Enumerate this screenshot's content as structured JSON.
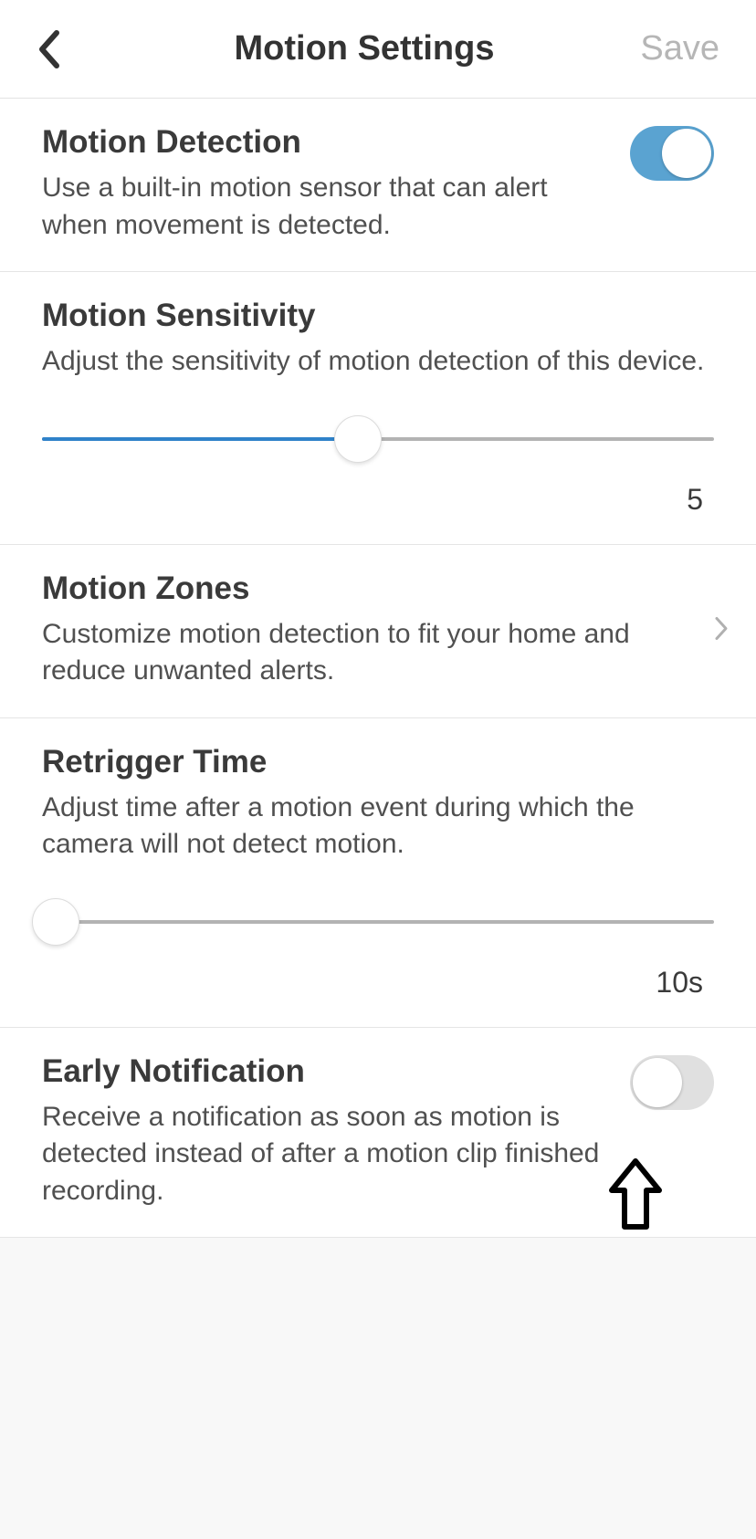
{
  "header": {
    "title": "Motion Settings",
    "save_label": "Save"
  },
  "sections": {
    "motion_detection": {
      "title": "Motion Detection",
      "desc": "Use a built-in motion sensor that can alert when movement is detected.",
      "toggle_on": true
    },
    "motion_sensitivity": {
      "title": "Motion Sensitivity",
      "desc": "Adjust the sensitivity of motion detection of this device.",
      "value": "5",
      "slider_percent": 47
    },
    "motion_zones": {
      "title": "Motion Zones",
      "desc": "Customize motion detection to fit your home and reduce unwanted alerts."
    },
    "retrigger_time": {
      "title": "Retrigger Time",
      "desc": "Adjust time after a motion event during which the camera will not detect motion.",
      "value": "10s",
      "slider_percent": 2
    },
    "early_notification": {
      "title": "Early Notification",
      "desc": "Receive a notification as soon as motion is detected instead of after a motion clip finished recording.",
      "toggle_on": false
    }
  }
}
